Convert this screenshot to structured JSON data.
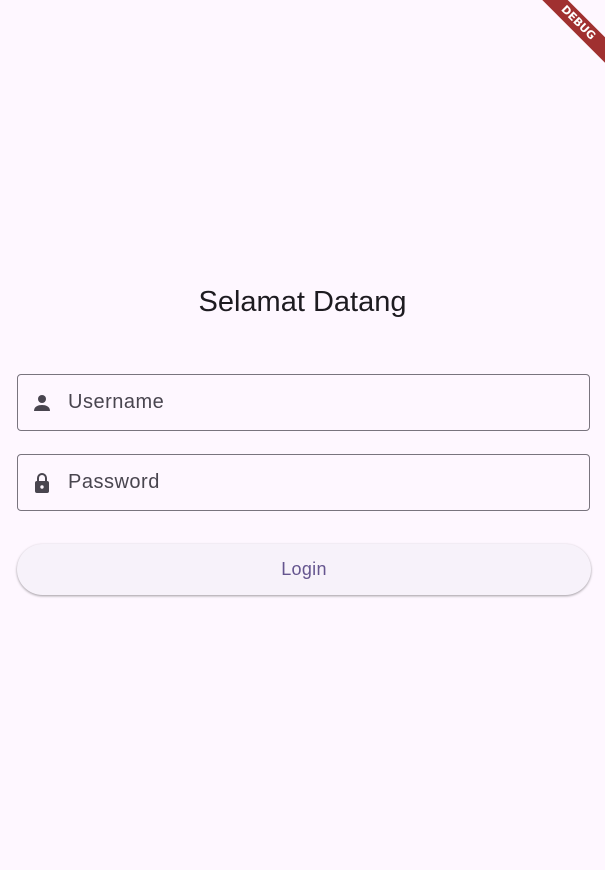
{
  "debug_banner": {
    "label": "DEBUG"
  },
  "login": {
    "title": "Selamat Datang",
    "username": {
      "placeholder": "Username",
      "value": "",
      "icon": "person-icon"
    },
    "password": {
      "placeholder": "Password",
      "value": "",
      "icon": "lock-icon"
    },
    "submit_label": "Login"
  },
  "colors": {
    "background": "#fef7ff",
    "outline": "#79747e",
    "icon": "#49454f",
    "primary": "#65558f",
    "button_surface": "#f7f2fa",
    "debug_ribbon": "#a03030"
  }
}
